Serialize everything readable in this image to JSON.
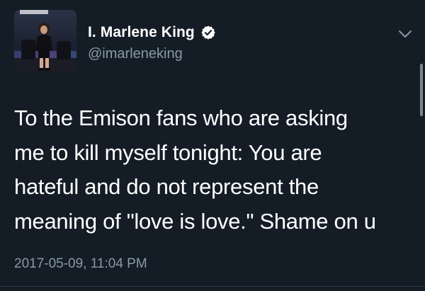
{
  "tweet": {
    "author": {
      "display_name": "I. Marlene King",
      "handle": "@imarleneking",
      "verified": true,
      "avatar_icon": "profile-photo"
    },
    "text": "To the Emison fans who are asking\nme to kill myself tonight: You are\nhateful and do not represent the\nmeaning of \"love is love.\"  Shame on u",
    "timestamp": "2017-05-09, 11:04 PM",
    "menu_icon": "chevron-down-icon"
  },
  "theme": {
    "background": "#141d26",
    "text_primary": "#ffffff",
    "text_secondary": "#8899a6",
    "verified_badge": "#ffffff"
  }
}
